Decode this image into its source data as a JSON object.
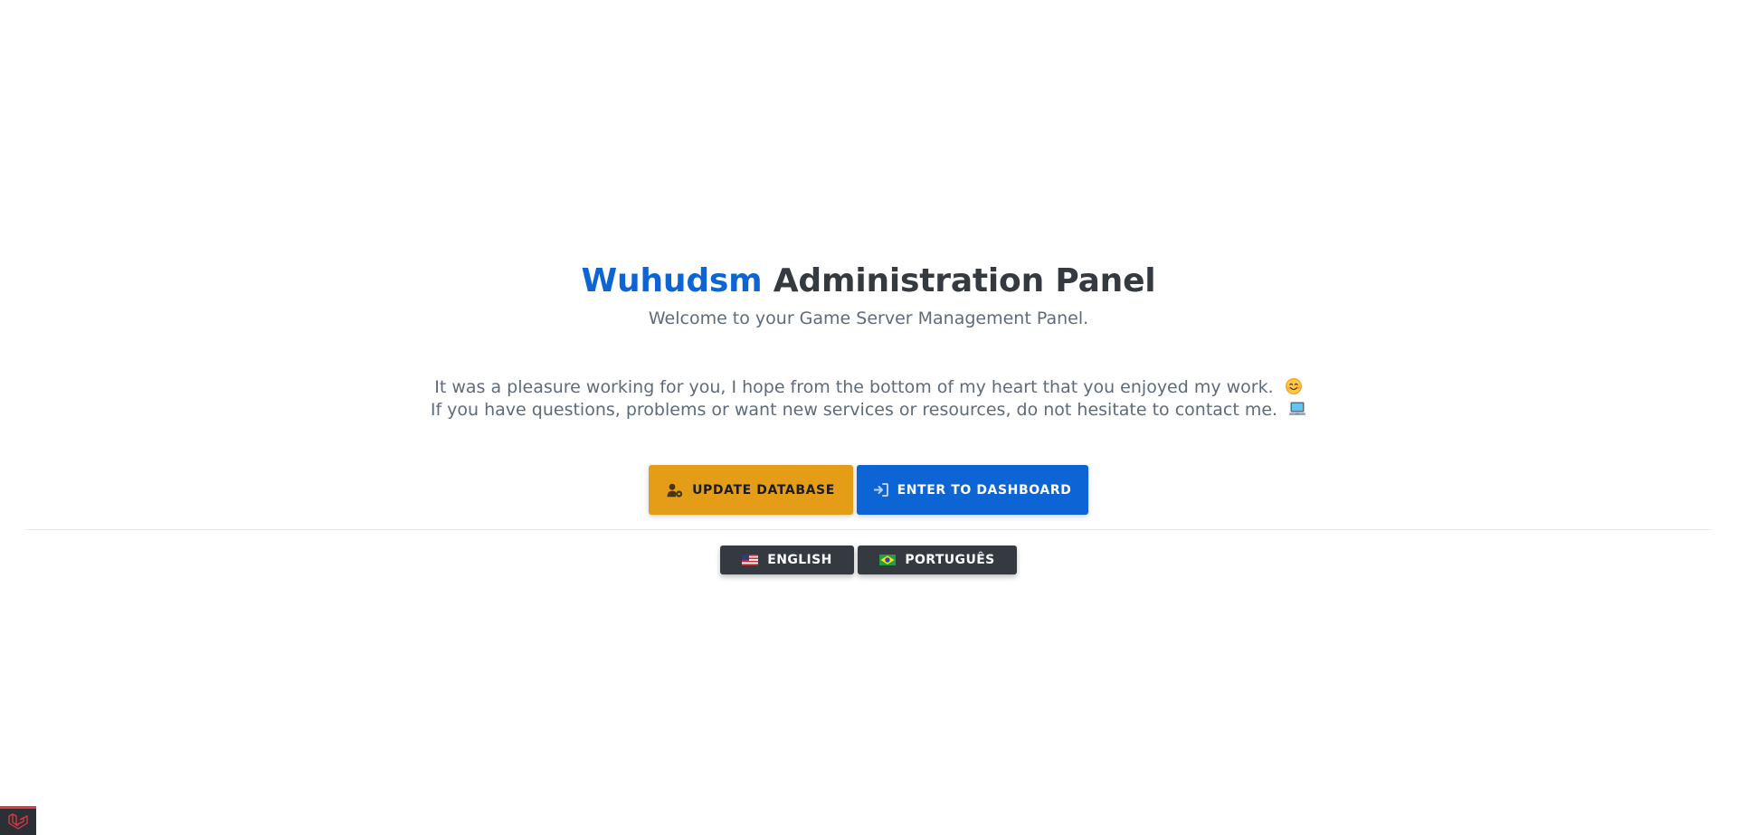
{
  "header": {
    "brand": "Wuhudsm",
    "title_rest": " Administration Panel",
    "subtitle": "Welcome to your Game Server Management Panel."
  },
  "message": {
    "line1": "It was a pleasure working for you, I hope from the bottom of my heart that you enjoyed my work.",
    "line2": "If you have questions, problems or want new services or resources, do not hesitate to contact me."
  },
  "actions": {
    "update_label": "UPDATE DATABASE",
    "enter_label": "ENTER TO DASHBOARD"
  },
  "languages": [
    {
      "label": "ENGLISH",
      "flag": "us-flag-icon"
    },
    {
      "label": "PORTUGUÊS",
      "flag": "br-flag-icon"
    }
  ],
  "colors": {
    "brand_blue": "#0d64d4",
    "update_button": "#e59d17",
    "language_button": "#343a40",
    "title_text": "#343a40",
    "body_text": "#5f6b7a"
  },
  "icons": {
    "update_button": "user-cog-icon",
    "enter_button": "sign-in-icon",
    "line1_emoji": "smiling-face-emoji-icon",
    "line2_emoji": "laptop-computer-emoji-icon",
    "corner_badge": "laravel-logo-icon"
  }
}
